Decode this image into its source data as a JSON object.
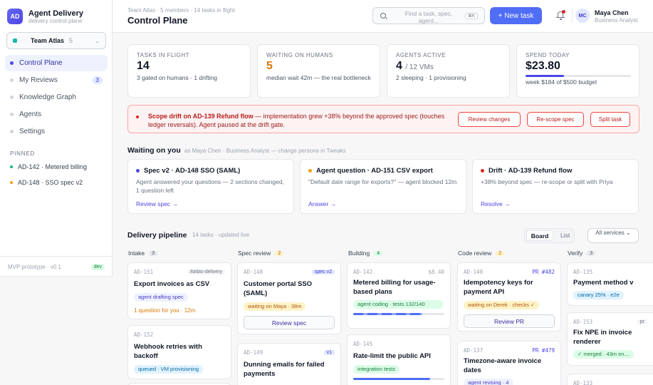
{
  "app": {
    "logo": "AD",
    "title": "Agent Delivery",
    "subtitle": "delivery control plane"
  },
  "team_selector": {
    "name": "Team Atlas",
    "count": "5",
    "chevron": "⌄"
  },
  "nav": [
    {
      "label": "Control Plane",
      "active": true
    },
    {
      "label": "My Reviews",
      "badge": "3"
    },
    {
      "label": "Knowledge Graph"
    },
    {
      "label": "Agents"
    },
    {
      "label": "Settings"
    }
  ],
  "pinned": {
    "heading": "PINNED",
    "items": [
      {
        "label": "AD-142 · Metered billing",
        "color": "#10b981"
      },
      {
        "label": "AD-148 · SSO spec v2",
        "color": "#f59e0b"
      }
    ]
  },
  "sidebar_footer": {
    "version": "MVP prototype · v0.1",
    "env": "dev"
  },
  "header": {
    "breadcrumb": "Team Atlas · 5 members · 14 tasks in flight",
    "title": "Control Plane",
    "search_placeholder": "Find a task, spec, agent...",
    "search_shortcut": "⌘K",
    "new_task": "+ New task",
    "user": {
      "initials": "MC",
      "name": "Maya Chen",
      "role": "Business Analyst"
    }
  },
  "kpis": [
    {
      "label": "TASKS IN FLIGHT",
      "value": "14",
      "sub": "3 gated on humans · 1 drifting"
    },
    {
      "label": "WAITING ON HUMANS",
      "value": "5",
      "sub": "median wait 42m — the real bottleneck",
      "color": "#d97706"
    },
    {
      "label": "AGENTS ACTIVE",
      "value": "4",
      "value_suffix": "/ 12 VMs",
      "sub": "2 sleeping · 1 provisioning"
    },
    {
      "label": "SPEND TODAY",
      "value": "$23.80",
      "sub": "week $184 of $500 budget",
      "budget_fraction": 0.368
    }
  ],
  "alert": {
    "title": "Scope drift on AD-139 Refund flow",
    "body": " — implementation grew +38% beyond the approved spec (touches ledger reversals). Agent paused at the drift gate.",
    "actions": [
      "Review changes",
      "Re-scope spec",
      "Split task"
    ]
  },
  "waiting": {
    "title": "Waiting on you",
    "subtitle": "as Maya Chen · Business Analyst — change persona in Tweaks",
    "cards": [
      {
        "title": "Spec v2 · AD-148 SSO (SAML)",
        "body": "Agent answered your questions — 2 sections changed, 1 question left",
        "link": "Review spec →",
        "color": "#4f46e5"
      },
      {
        "title": "Agent question · AD-151 CSV export",
        "body": "\"Default date range for exports?\" — agent blocked 12m",
        "link": "Answer →",
        "color": "#f59e0b"
      },
      {
        "title": "Drift · AD-139 Refund flow",
        "body": "+38% beyond spec — re-scope or split with Priya",
        "link": "Resolve →",
        "color": "#dc2626"
      }
    ]
  },
  "pipeline": {
    "title": "Delivery pipeline",
    "subtitle": "14 tasks · updated live",
    "views": [
      "Board",
      "List"
    ],
    "filter": "All services ⌄",
    "columns": [
      {
        "name": "Intake",
        "count": "3",
        "cards": [
          {
            "id": "AD-151",
            "tag": "#atlas-delivery",
            "title": "Export invoices as CSV",
            "chip": "agent drafting spec",
            "chip_style": "indigo",
            "note": "1 question for you · 12m"
          },
          {
            "id": "AD-152",
            "title": "Webhook retries with backoff",
            "chip": "queued · VM provisioning",
            "chip_style": "teal"
          }
        ]
      },
      {
        "name": "Spec review",
        "count": "2",
        "cards": [
          {
            "id": "AD-148",
            "tag": "spec v2",
            "title": "Customer portal SSO (SAML)",
            "chip": "waiting on Maya · 38m",
            "chip_style": "amber",
            "button": "Review spec"
          },
          {
            "id": "AD-149",
            "tag": "v1",
            "title": "Dunning emails for failed payments"
          }
        ]
      },
      {
        "name": "Building",
        "count": "4",
        "cards": [
          {
            "id": "AD-142",
            "tag": "$8.40",
            "title": "Metered billing for usage-based plans",
            "chip": "agent coding · tests 132/140",
            "chip_style": "green",
            "progress": 0.76
          },
          {
            "id": "AD-145",
            "title": "Rate-limit the public API",
            "chip": "integration tests",
            "chip_style": "green",
            "progress": 0.84
          }
        ]
      },
      {
        "name": "Code review",
        "count": "2",
        "cards": [
          {
            "id": "AD-140",
            "tag": "PR #482",
            "title": "Idempotency keys for payment API",
            "chip": "waiting on Derek · checks ✓",
            "chip_style": "amber",
            "button": "Review PR"
          },
          {
            "id": "AD-137",
            "tag": "PR #479",
            "title": "Timezone-aware invoice dates",
            "chip": "agent revising · 4",
            "chip_style": "indigo"
          }
        ]
      },
      {
        "name": "Verify",
        "count": "3",
        "cards": [
          {
            "id": "AD-135",
            "title": "Payment method v",
            "chip": "canary 25% · e2e",
            "chip_style": "teal"
          },
          {
            "id": "AD-153",
            "tag": "pr",
            "title": "Fix NPE in invoice renderer",
            "chip": "✓ merged · 43m en…",
            "chip_style": "green"
          },
          {
            "id": "AD-133"
          }
        ]
      }
    ]
  },
  "colors": {
    "accent": "#4f46e5",
    "button": "#4f6df5",
    "danger": "#dc2626",
    "warning": "#d97706"
  }
}
